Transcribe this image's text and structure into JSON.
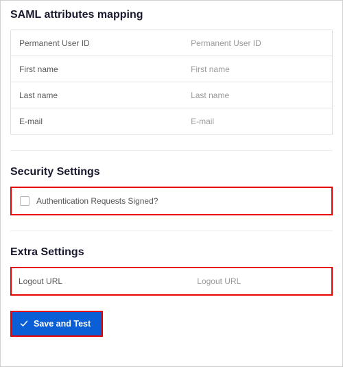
{
  "saml": {
    "heading": "SAML attributes mapping",
    "rows": [
      {
        "label": "Permanent User ID",
        "placeholder": "Permanent User ID",
        "value": ""
      },
      {
        "label": "First name",
        "placeholder": "First name",
        "value": ""
      },
      {
        "label": "Last name",
        "placeholder": "Last name",
        "value": ""
      },
      {
        "label": "E-mail",
        "placeholder": "E-mail",
        "value": ""
      }
    ]
  },
  "security": {
    "heading": "Security Settings",
    "checkbox": {
      "label": "Authentication Requests Signed?",
      "checked": false
    }
  },
  "extra": {
    "heading": "Extra Settings",
    "logout": {
      "label": "Logout URL",
      "placeholder": "Logout URL",
      "value": ""
    }
  },
  "actions": {
    "save_label": "Save and Test"
  },
  "colors": {
    "highlight": "#e60000",
    "primary_button": "#0a5fd6"
  }
}
